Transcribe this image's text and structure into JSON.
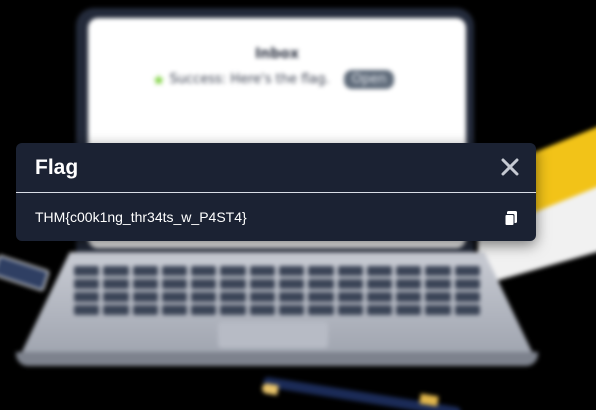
{
  "background": {
    "laptop_screen": {
      "title": "Inbox",
      "message": "Success: Here's the flag.",
      "button_label": "Open",
      "star_icon": "star-icon",
      "star_color": "#7ad03a"
    }
  },
  "modal": {
    "title": "Flag",
    "flag_value": "THM{c00k1ng_thr34ts_w_P4ST4}",
    "close_icon": "close-icon",
    "copy_icon": "copy-icon",
    "background_color": "#1b2233",
    "text_color": "#ffffff"
  }
}
